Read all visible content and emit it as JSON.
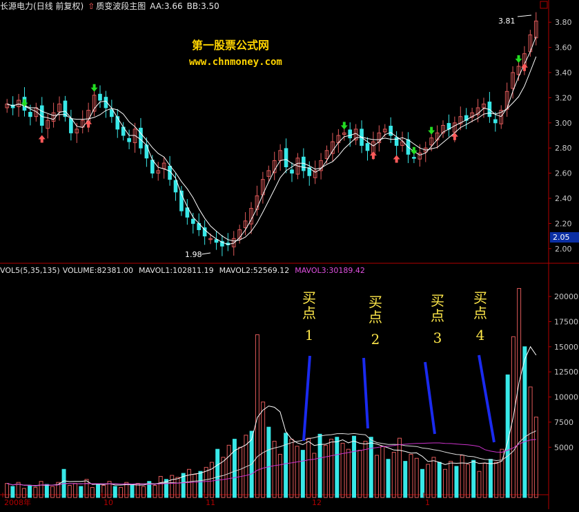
{
  "header": {
    "stock_name": "长源电力",
    "period_label": "(日线 前复权)",
    "arrow_glyph": "⇧",
    "indicator_name": "质变波段主图",
    "aa": "AA:3.66",
    "bb": "BB:3.50"
  },
  "watermark": {
    "line1": "第一股票公式网",
    "line2": "www.chnmoney.com"
  },
  "volume_header": {
    "vol": "VOL5(5,35,135)",
    "volume": "VOLUME:82381.00",
    "mavol1": "MAVOL1:102811.19",
    "mavol2": "MAVOL2:52569.12",
    "mavol3": "MAVOL3:30189.42"
  },
  "annotations": {
    "high_label": "3.81",
    "low_label": "1.98",
    "current_price": "2.05",
    "buy_points": [
      {
        "line1": "买",
        "line2": "点",
        "num": "1"
      },
      {
        "line1": "买",
        "line2": "点",
        "num": "2"
      },
      {
        "line1": "买",
        "line2": "点",
        "num": "3"
      },
      {
        "line1": "买",
        "line2": "点",
        "num": "4"
      }
    ]
  },
  "date_axis": [
    "2008年",
    "10",
    "11",
    "12",
    "1"
  ],
  "colors": {
    "up": "#e05a5a",
    "down": "#38e8e8",
    "ma_white": "#ffffff",
    "mavol3": "#cc33cc",
    "buy_arrow": "#ff5a5a",
    "sell_arrow": "#22dd22",
    "blue_line": "#1a2aee",
    "axis": "#b40000",
    "header_text": "#e6e6e6",
    "header_yellow": "#f0f000",
    "header_magenta": "#e050e0"
  },
  "chart_data": [
    {
      "type": "candlestick",
      "title": "长源电力(日线 前复权)",
      "ylim": [
        1.9,
        3.9
      ],
      "yticks": [
        "3.80",
        "3.60",
        "3.40",
        "3.20",
        "3.00",
        "2.80",
        "2.60",
        "2.40",
        "2.20",
        "2.00"
      ],
      "ytick_values": [
        3.8,
        3.6,
        3.4,
        3.2,
        3.0,
        2.8,
        2.6,
        2.4,
        2.2,
        2.0
      ],
      "close": [
        3.15,
        3.12,
        3.18,
        3.1,
        3.05,
        3.12,
        2.98,
        3.02,
        3.08,
        3.15,
        3.05,
        2.92,
        2.95,
        3.02,
        3.1,
        3.22,
        3.18,
        3.12,
        3.05,
        2.95,
        2.9,
        2.85,
        2.95,
        2.8,
        2.72,
        2.6,
        2.62,
        2.68,
        2.55,
        2.45,
        2.3,
        2.25,
        2.2,
        2.15,
        2.1,
        2.08,
        2.05,
        2.02,
        2.03,
        2.08,
        2.15,
        2.22,
        2.32,
        2.42,
        2.55,
        2.62,
        2.7,
        2.78,
        2.65,
        2.6,
        2.72,
        2.62,
        2.58,
        2.62,
        2.7,
        2.78,
        2.85,
        2.9,
        2.92,
        2.88,
        2.95,
        2.82,
        2.78,
        2.85,
        2.92,
        2.95,
        2.9,
        2.82,
        2.85,
        2.75,
        2.72,
        2.76,
        2.8,
        2.88,
        2.92,
        2.98,
        2.95,
        3.0,
        3.05,
        3.02,
        3.08,
        3.12,
        3.15,
        3.05,
        3.0,
        3.1,
        3.25,
        3.4,
        3.45,
        3.55,
        3.7,
        3.81
      ],
      "mavol_note": "moving averages drawn as smoothed white lines"
    },
    {
      "type": "bar",
      "title": "VOL5(5,35,135)",
      "ylim": [
        0,
        22000
      ],
      "yticks": [
        "20000",
        "17500",
        "15000",
        "12500",
        "10000",
        "7500",
        "5000"
      ],
      "ytick_values": [
        20000,
        17500,
        15000,
        12500,
        10000,
        7500,
        5000
      ],
      "values": [
        1400,
        1100,
        1500,
        900,
        1200,
        1000,
        1600,
        1300,
        1100,
        1500,
        2800,
        1200,
        1400,
        1100,
        1800,
        1000,
        1300,
        1200,
        1600,
        1100,
        1000,
        1500,
        1200,
        1400,
        1100,
        1600,
        1200,
        2100,
        1800,
        2200,
        2000,
        2400,
        2800,
        2300,
        2600,
        3000,
        3500,
        4800,
        4000,
        5200,
        5800,
        5000,
        6200,
        6600,
        16200,
        9500,
        7000,
        5600,
        4300,
        6400,
        5800,
        5100,
        4700,
        5900,
        4400,
        6300,
        5200,
        5800,
        6000,
        5400,
        4800,
        6100,
        4700,
        5600,
        6000,
        4200,
        5100,
        3800,
        4500,
        5900,
        3600,
        4300,
        3900,
        2800,
        3300,
        4000,
        3500,
        2800,
        3600,
        3100,
        4200,
        3300,
        3700,
        2600,
        3400,
        3800,
        3500,
        4800,
        12200,
        16000,
        20800,
        15000,
        11000,
        8000
      ],
      "ma_values_note": "white line MAVOL1, pink/magenta line MAVOL3"
    }
  ]
}
